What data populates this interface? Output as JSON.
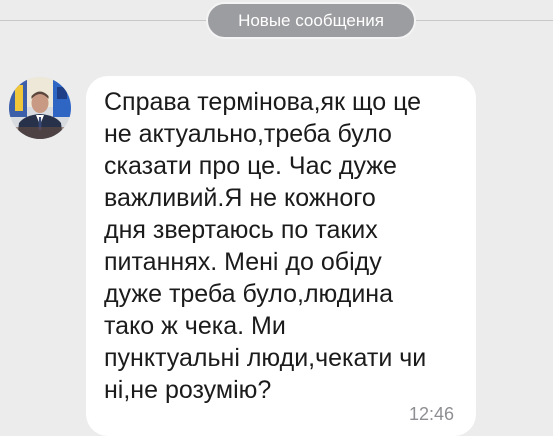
{
  "divider": {
    "label": "Новые сообщения"
  },
  "message": {
    "avatar_icon": "person-avatar-icon",
    "text": "Справа термінова,як що це\nне актуально,треба було\nсказати про це. Час дуже\nважливий.Я не кожного\nдня звертаюсь по таких\nпитаннях. Мені до обіду\nдуже треба було,людина\nтако ж чека. Ми\nпунктуальні люди,чекати чи\nні,не розумію?",
    "time": "12:46"
  },
  "colors": {
    "background": "#ececed",
    "bubble": "#ffffff",
    "pill": "#9c9da0",
    "time": "#8e8f93"
  }
}
